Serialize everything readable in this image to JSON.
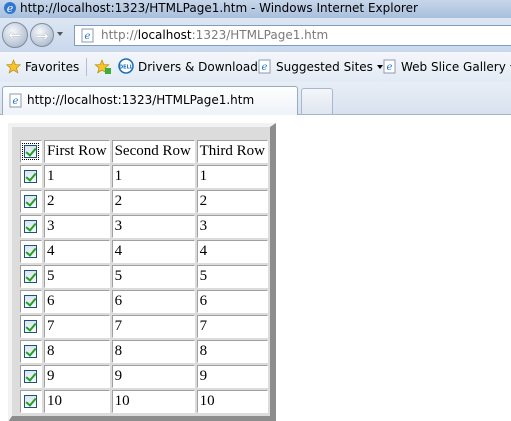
{
  "window": {
    "title": "http://localhost:1323/HTMLPage1.htm - Windows Internet Explorer"
  },
  "address": {
    "prefix": "http://",
    "host": "localhost",
    "rest": ":1323/HTMLPage1.htm",
    "icon": "ie-page-icon"
  },
  "favorites_bar": {
    "favorites_label": "Favorites",
    "items": [
      {
        "label": "Drivers & Downloads",
        "icon": "dell-icon"
      },
      {
        "label": "Suggested Sites",
        "icon": "ie-page-icon",
        "has_dropdown": true
      },
      {
        "label": "Web Slice Gallery",
        "icon": "ie-page-icon",
        "has_dropdown": true
      }
    ]
  },
  "tabs": [
    {
      "label": "http://localhost:1323/HTMLPage1.htm",
      "active": true
    }
  ],
  "grid": {
    "header": {
      "checked": true,
      "columns": [
        "First Row",
        "Second Row",
        "Third Row"
      ]
    },
    "rows": [
      {
        "checked": true,
        "cells": [
          "1",
          "1",
          "1"
        ]
      },
      {
        "checked": true,
        "cells": [
          "2",
          "2",
          "2"
        ]
      },
      {
        "checked": true,
        "cells": [
          "3",
          "3",
          "3"
        ]
      },
      {
        "checked": true,
        "cells": [
          "4",
          "4",
          "4"
        ]
      },
      {
        "checked": true,
        "cells": [
          "5",
          "5",
          "5"
        ]
      },
      {
        "checked": true,
        "cells": [
          "6",
          "6",
          "6"
        ]
      },
      {
        "checked": true,
        "cells": [
          "7",
          "7",
          "7"
        ]
      },
      {
        "checked": true,
        "cells": [
          "8",
          "8",
          "8"
        ]
      },
      {
        "checked": true,
        "cells": [
          "9",
          "9",
          "9"
        ]
      },
      {
        "checked": true,
        "cells": [
          "10",
          "10",
          "10"
        ]
      }
    ]
  }
}
